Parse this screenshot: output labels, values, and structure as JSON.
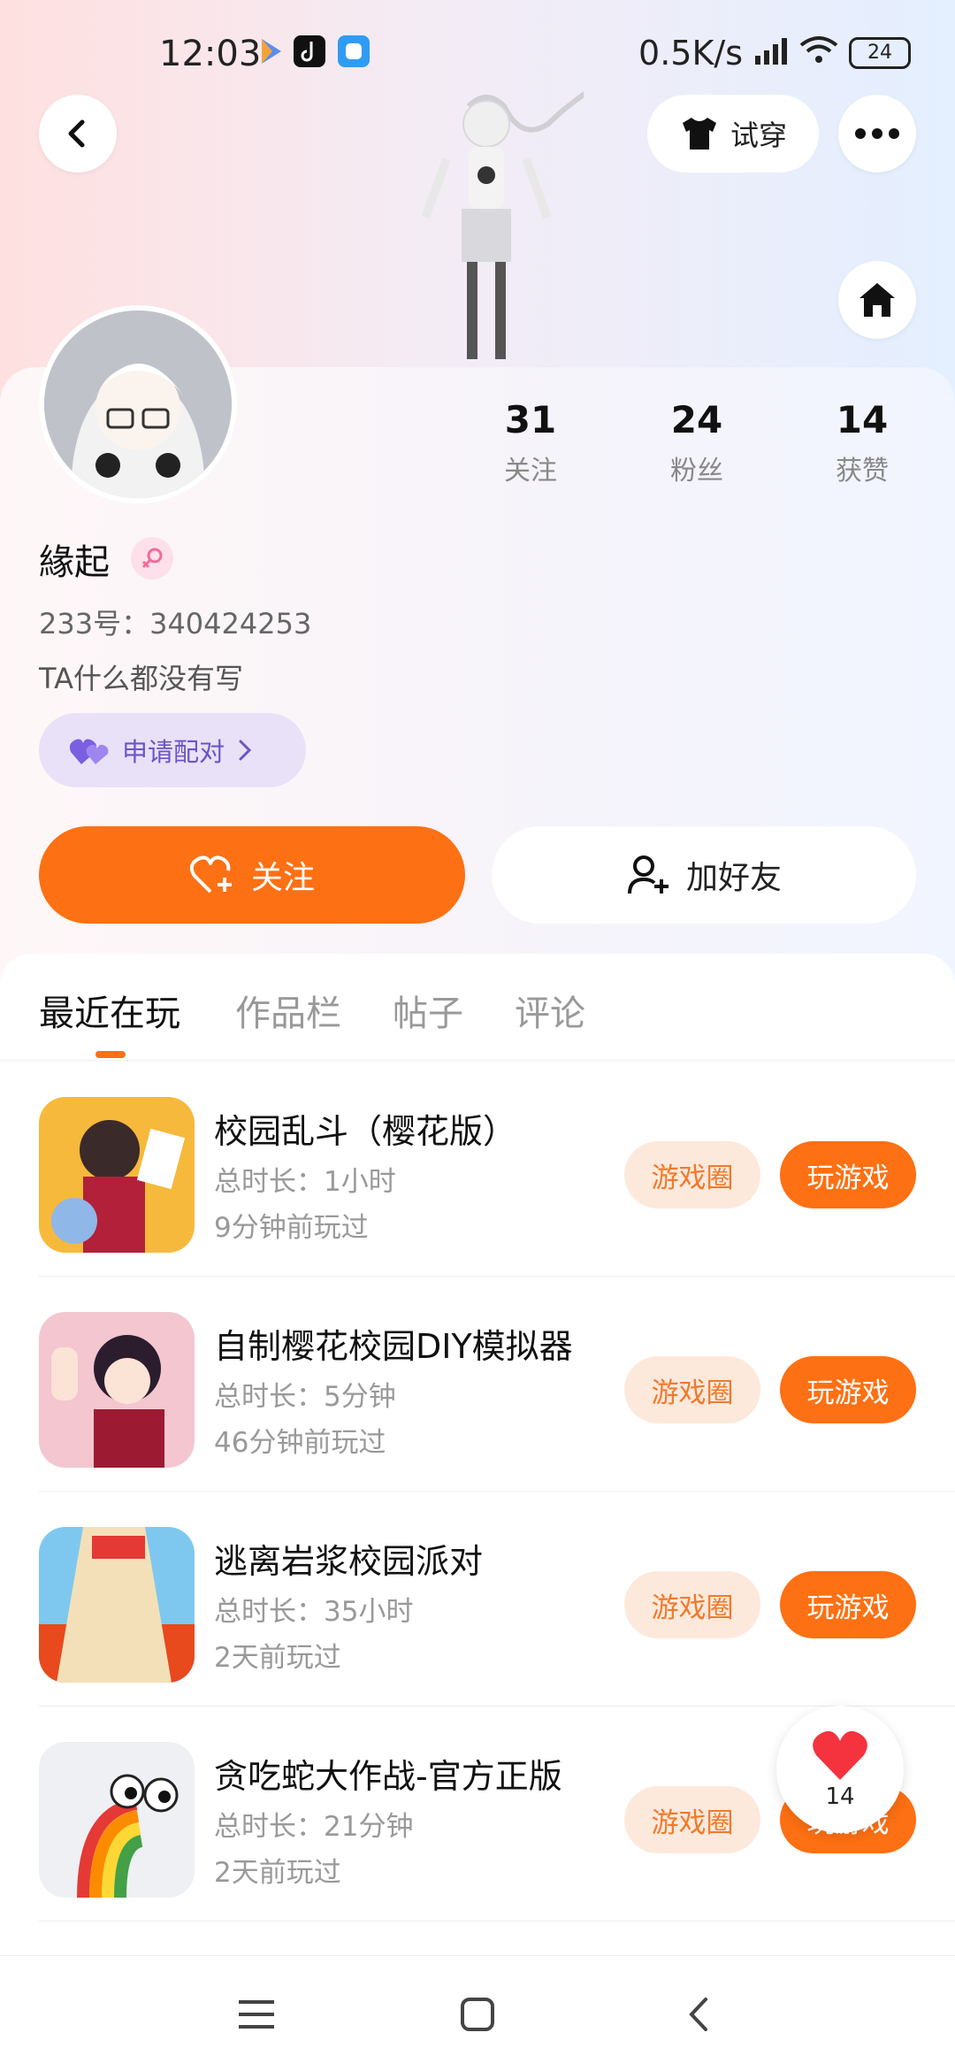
{
  "status_bar": {
    "time": "12:03",
    "network_speed": "0.5K/s",
    "battery": "24"
  },
  "header": {
    "try_on_label": "试穿"
  },
  "profile": {
    "username": "緣起",
    "uid": "233号：340424253",
    "bio": "TA什么都没有写",
    "pair_label": "申请配对",
    "stats": [
      {
        "num": "31",
        "label": "关注"
      },
      {
        "num": "24",
        "label": "粉丝"
      },
      {
        "num": "14",
        "label": "获赞"
      }
    ],
    "follow_label": "关注",
    "add_friend_label": "加好友"
  },
  "tabs": [
    {
      "label": "最近在玩"
    },
    {
      "label": "作品栏"
    },
    {
      "label": "帖子"
    },
    {
      "label": "评论"
    }
  ],
  "games": [
    {
      "title": "校园乱斗（樱花版）",
      "duration": "总时长：1小时",
      "last_played": "9分钟前玩过",
      "circle_label": "游戏圈",
      "play_label": "玩游戏"
    },
    {
      "title": "自制樱花校园DIY模拟器",
      "duration": "总时长：5分钟",
      "last_played": "46分钟前玩过",
      "circle_label": "游戏圈",
      "play_label": "玩游戏"
    },
    {
      "title": "逃离岩浆校园派对",
      "duration": "总时长：35小时",
      "last_played": "2天前玩过",
      "circle_label": "游戏圈",
      "play_label": "玩游戏"
    },
    {
      "title": "贪吃蛇大作战-官方正版",
      "duration": "总时长：21分钟",
      "last_played": "2天前玩过",
      "circle_label": "游戏圈",
      "play_label": "玩游戏"
    }
  ],
  "like_float": {
    "count": "14"
  },
  "colors": {
    "accent": "#fd7013",
    "accent_light": "#fde9dc",
    "pair": "#6a55c8"
  }
}
